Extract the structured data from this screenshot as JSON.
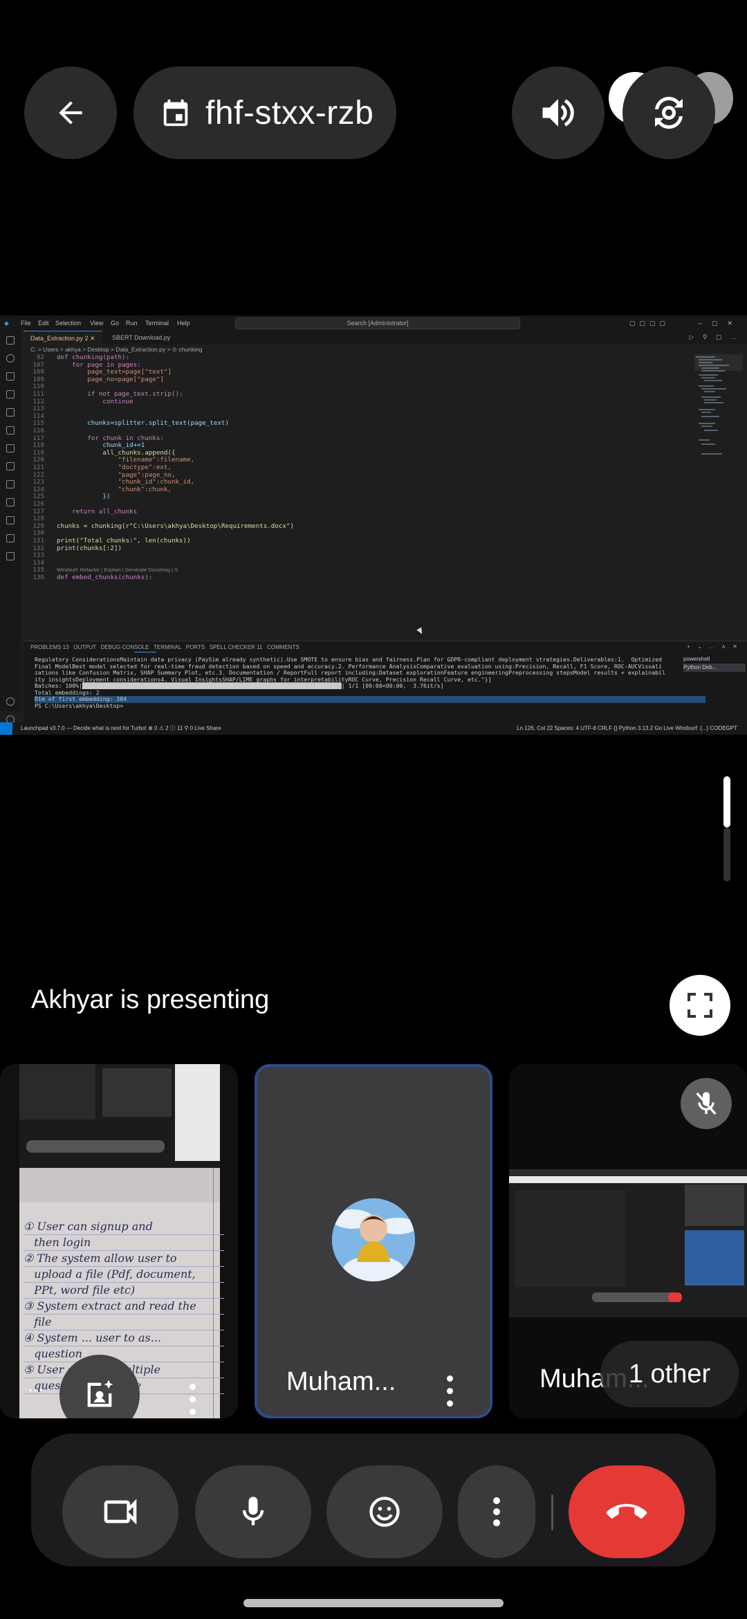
{
  "meeting": {
    "code": "fhf-stxx-rzb",
    "presenting_text": "Akhyar is presenting"
  },
  "shared_screen": {
    "menu": [
      "File",
      "Edit",
      "Selection",
      "View",
      "Go",
      "Run",
      "Terminal",
      "Help"
    ],
    "search": "Search [Administrator]",
    "tabs": [
      "Data_Extraction.py 2",
      "SBERT Download.py"
    ],
    "breadcrumb": "C: > Users > akhya > Desktop > Data_Extraction.py > ⊙ chunking",
    "code_lines": [
      [
        "92",
        "def chunking(path):"
      ],
      [
        "107",
        "    for page in pages:"
      ],
      [
        "108",
        "        page_text=page[\"text\"]"
      ],
      [
        "109",
        "        page_no=page[\"page\"]"
      ],
      [
        "110",
        ""
      ],
      [
        "111",
        "        if not page_text.strip():"
      ],
      [
        "112",
        "            continue"
      ],
      [
        "113",
        ""
      ],
      [
        "114",
        ""
      ],
      [
        "115",
        "        chunks=splitter.split_text(page_text)"
      ],
      [
        "116",
        ""
      ],
      [
        "117",
        "        for chunk in chunks:"
      ],
      [
        "118",
        "            chunk_id+=1"
      ],
      [
        "119",
        "            all_chunks.append({"
      ],
      [
        "120",
        "                \"filename\":filename,"
      ],
      [
        "121",
        "                \"doctype\":ext,"
      ],
      [
        "122",
        "                \"page\":page_no,"
      ],
      [
        "123",
        "                \"chunk_id\":chunk_id,"
      ],
      [
        "124",
        "                \"chunk\":chunk,"
      ],
      [
        "125",
        "            })"
      ],
      [
        "126",
        ""
      ],
      [
        "127",
        "    return all_chunks"
      ],
      [
        "128",
        ""
      ],
      [
        "129",
        "chunks = chunking(r\"C:\\Users\\akhya\\Desktop\\Requirements.docx\")"
      ],
      [
        "130",
        ""
      ],
      [
        "131",
        "print(\"Total chunks:\", len(chunks))"
      ],
      [
        "132",
        "print(chunks[:2])"
      ],
      [
        "133",
        ""
      ],
      [
        "134",
        ""
      ],
      [
        "135",
        "Windsurf: Refactor | Explain | Generate Docstring | X"
      ],
      [
        "136",
        "def embed_chunks(chunks):"
      ]
    ],
    "panel_tabs": "PROBLEMS 13   OUTPUT   DEBUG CONSOLE   TERMINAL   PORTS   SPELL CHECKER 11   COMMENTS",
    "terminal_lines": [
      "Regulatory ConsiderationsMaintain data privacy (PaySim already synthetic).Use SMOTE to ensure bias and fairness.Plan for GDPR-compliant deployment strategies.Deliverables:1.  Optimized",
      "Final ModelBest model selected for real-time fraud detection based on speed and accuracy.2. Performance AnalysisComparative evaluation using:Precision, Recall, F1 Score, ROC-AUCVisuali",
      "zations like Confusion Matrix, SHAP Summary Plot, etc.3. Documentation / ReportFull report including:Dataset explorationFeature engineeringPreprocessing stepsModel results + explainabil",
      "ity insightsDeployment considerations4. Visual InsightsSHAP/LIME graphs for interpretabilityROC Curve, Precision Recall Curve, etc.\"}]",
      "Batches: 100%|████████████████████████████████████████████████████████████████████████████| 1/1 [00:00<00:00,  3.76it/s]",
      "Total embeddings: 2",
      "Dim of first embedding: 384",
      "PS C:\\Users\\akhya\\Desktop> "
    ],
    "terminal_side": [
      "powershell",
      "Python Deb..."
    ],
    "statusbar_left": "Launchpad   v3.7.0 — Decide what is next for Turbo!   ⊗ 0 ⚠ 2 ⓘ 11   ⚲ 0   Live Share",
    "statusbar_right": "Ln 126, Col 22   Spaces: 4   UTF-8   CRLF   {} Python   3.13.2   Go Live   Windsurf: {...}   CODEGPT"
  },
  "participants": [
    {
      "name": "...",
      "muted": false
    },
    {
      "name": "Muham...",
      "muted": false
    },
    {
      "name": "Muham...",
      "extra": "1 other",
      "muted": true
    }
  ],
  "notebook": {
    "lines": [
      "① User can signup and",
      "   then login",
      "② The system allow user to",
      "   upload a file (Pdf, document,",
      "   PPt, word file etc)",
      "③ System extract and read the",
      "   file",
      "④ System ... user to as...",
      "   question",
      "⑤ User can ask Multiple",
      "   questions at a time"
    ]
  },
  "colors": {
    "end_call": "#e53935",
    "active_tile_border": "#2e4a8a",
    "button_bg": "#3a3a3c"
  },
  "icons": [
    "back-arrow-icon",
    "calendar-icon",
    "speaker-icon",
    "switch-camera-icon",
    "fullscreen-icon",
    "camera-icon",
    "microphone-icon",
    "emoji-icon",
    "more-vert-icon",
    "end-call-icon",
    "mic-off-icon",
    "sparkle-portrait-icon"
  ]
}
